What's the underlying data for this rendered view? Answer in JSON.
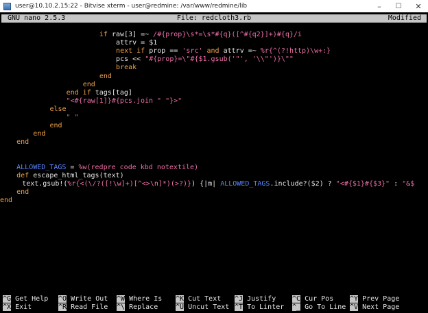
{
  "window": {
    "title": "user@10.10.2.15:22 - Bitvise xterm - user@redmine: /var/www/redmine/lib",
    "minimize": "–",
    "maximize": "☐",
    "close": "✕"
  },
  "nano": {
    "version": "GNU nano 2.5.3",
    "file": "File: redcloth3.rb",
    "status": "Modified"
  },
  "code_lines": [
    {
      "indent": 18,
      "tokens": [
        {
          "c": "kw",
          "t": "if "
        },
        {
          "c": "tx",
          "t": "raw[3] =~ "
        },
        {
          "c": "str",
          "t": "/#{prop}\\s*=\\s*#{q}([^#{q2}]+)#{q}/i"
        }
      ]
    },
    {
      "indent": 21,
      "tokens": [
        {
          "c": "tx",
          "t": "attrv = $1"
        }
      ]
    },
    {
      "indent": 21,
      "tokens": [
        {
          "c": "kw",
          "t": "next if "
        },
        {
          "c": "tx",
          "t": "prop == "
        },
        {
          "c": "str",
          "t": "'src'"
        },
        {
          "c": "kw",
          "t": " and "
        },
        {
          "c": "tx",
          "t": "attrv =~ "
        },
        {
          "c": "str",
          "t": "%r{^(?!http)\\w+:}"
        }
      ]
    },
    {
      "indent": 21,
      "tokens": [
        {
          "c": "tx",
          "t": "pcs << "
        },
        {
          "c": "str",
          "t": "\"#{prop}=\\\"#{$1.gsub('\"', '\\\\\"')}\\\"\""
        }
      ]
    },
    {
      "indent": 21,
      "tokens": [
        {
          "c": "kw",
          "t": "break"
        }
      ]
    },
    {
      "indent": 18,
      "tokens": [
        {
          "c": "kw",
          "t": "end"
        }
      ]
    },
    {
      "indent": 15,
      "tokens": [
        {
          "c": "kw",
          "t": "end"
        }
      ]
    },
    {
      "indent": 12,
      "tokens": [
        {
          "c": "kw",
          "t": "end if "
        },
        {
          "c": "tx",
          "t": "tags[tag]"
        }
      ]
    },
    {
      "indent": 12,
      "tokens": [
        {
          "c": "str",
          "t": "\"<#{raw[1]}#{pcs.join \" \"}>\""
        }
      ]
    },
    {
      "indent": 9,
      "tokens": [
        {
          "c": "kw",
          "t": "else"
        }
      ]
    },
    {
      "indent": 12,
      "tokens": [
        {
          "c": "str",
          "t": "\" \""
        }
      ]
    },
    {
      "indent": 9,
      "tokens": [
        {
          "c": "kw",
          "t": "end"
        }
      ]
    },
    {
      "indent": 6,
      "tokens": [
        {
          "c": "kw",
          "t": "end"
        }
      ]
    },
    {
      "indent": 3,
      "tokens": [
        {
          "c": "kw",
          "t": "end"
        }
      ]
    },
    {
      "indent": 0,
      "tokens": []
    },
    {
      "indent": 0,
      "tokens": []
    },
    {
      "indent": 3,
      "tokens": [
        {
          "c": "ct",
          "t": "ALLOWED_TAGS"
        },
        {
          "c": "tx",
          "t": " = "
        },
        {
          "c": "str",
          "t": "%w(redpre code kbd notextile)"
        }
      ]
    },
    {
      "indent": 3,
      "tokens": [
        {
          "c": "kw",
          "t": "def "
        },
        {
          "c": "tx",
          "t": "escape_html_tags(text)"
        }
      ]
    },
    {
      "indent": 4,
      "tokens": [
        {
          "c": "tx",
          "t": "text.gsub!("
        },
        {
          "c": "str",
          "t": "%r{<(\\/?([!\\w]+)[^<>\\n]*)(>?)}"
        },
        {
          "c": "tx",
          "t": ") {|m| "
        },
        {
          "c": "ct",
          "t": "ALLOWED_TAGS"
        },
        {
          "c": "tx",
          "t": ".include?($2) ? "
        },
        {
          "c": "str",
          "t": "\"<#{$1}#{$3}\""
        },
        {
          "c": "tx",
          "t": " : "
        },
        {
          "c": "str",
          "t": "\"&$"
        }
      ]
    },
    {
      "indent": 3,
      "tokens": [
        {
          "c": "kw",
          "t": "end"
        }
      ]
    },
    {
      "indent": 0,
      "tokens": [
        {
          "c": "kw",
          "t": "end"
        }
      ]
    }
  ],
  "shortcuts": [
    [
      {
        "key": "^G",
        "label": "Get Help"
      },
      {
        "key": "^O",
        "label": "Write Out"
      },
      {
        "key": "^W",
        "label": "Where Is"
      },
      {
        "key": "^K",
        "label": "Cut Text"
      },
      {
        "key": "^J",
        "label": "Justify"
      },
      {
        "key": "^C",
        "label": "Cur Pos"
      },
      {
        "key": "^Y",
        "label": "Prev Page"
      }
    ],
    [
      {
        "key": "^X",
        "label": "Exit"
      },
      {
        "key": "^R",
        "label": "Read File"
      },
      {
        "key": "^\\",
        "label": "Replace"
      },
      {
        "key": "^U",
        "label": "Uncut Text"
      },
      {
        "key": "^T",
        "label": "To Linter"
      },
      {
        "key": "^_",
        "label": "Go To Line"
      },
      {
        "key": "^V",
        "label": "Next Page"
      }
    ]
  ]
}
